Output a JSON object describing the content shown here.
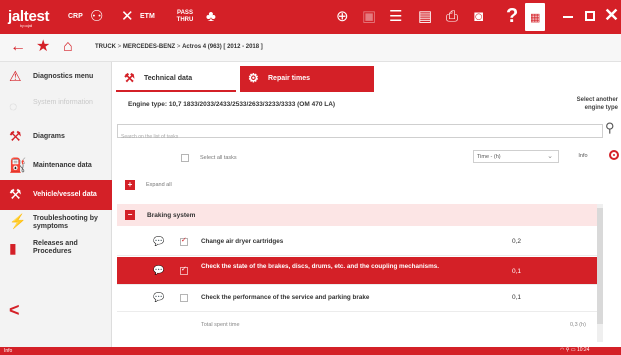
{
  "app": {
    "logo": "jaltest",
    "logo_sub": "by cojali",
    "toolbar": {
      "crp": "CRP",
      "etm": "ETM",
      "pass_thru": "PASS THRU",
      "help": "?",
      "grid_glyph": "▦",
      "close_glyph": "✕"
    }
  },
  "breadcrumb": {
    "sep": ">",
    "a": "TRUCK",
    "b": "MERCEDES-BENZ",
    "c": "Actros 4 (963) [ 2012 - 2018 ]"
  },
  "sidebar": {
    "items": [
      {
        "label": "Diagnostics menu",
        "icon": "warning-icon"
      },
      {
        "label": "System information",
        "icon": "info-icon"
      },
      {
        "label": "Diagrams",
        "icon": "wrench-icon"
      },
      {
        "label": "Maintenance data",
        "icon": "oil-can-icon"
      },
      {
        "label": "Vehicle/vessel data",
        "icon": "wrench-screwdriver-icon"
      },
      {
        "label": "Troubleshooting by symptoms",
        "icon": "troubleshooting-icon"
      },
      {
        "label": "Releases and Procedures",
        "icon": "book-icon"
      }
    ],
    "collapse": "<"
  },
  "tabs": {
    "technical": "Technical data",
    "repair": "Repair times"
  },
  "engine": {
    "label": "Engine type:",
    "value": "10,7 1833/2033/2433/2533/2633/3233/3333 (OM 470 LA)",
    "select_line1": "Select another",
    "select_line2": "engine type"
  },
  "search": {
    "placeholder": "Search on the list of tasks"
  },
  "controls": {
    "select_all": "Select all tasks",
    "time_unit": "Time - (h)",
    "info": "Info"
  },
  "expand_all": "Expand all",
  "section": {
    "title": "Braking system",
    "minus": "−",
    "plus": "+"
  },
  "tasks": [
    {
      "label": "Change air dryer cartridges",
      "time": "0,2",
      "checked": true
    },
    {
      "label": "Check the state of the brakes, discs, drums, etc. and the coupling mechanisms.",
      "time": "0,1",
      "checked": true
    },
    {
      "label": "Check the performance of the service and parking brake",
      "time": "0,1",
      "checked": false
    }
  ],
  "total": {
    "label": "Total spent time",
    "value": "0,3 (h)"
  },
  "status": {
    "left": "Info",
    "time": "10:24"
  },
  "colors": {
    "brand_red": "#d42027",
    "section_bg": "#fce5e5"
  }
}
